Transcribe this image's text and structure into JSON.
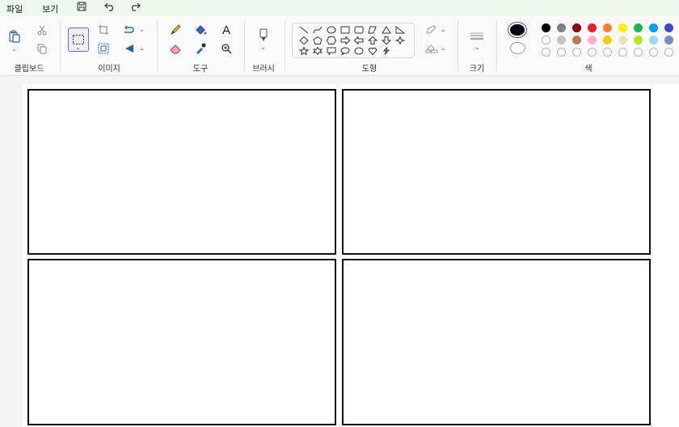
{
  "menu": {
    "file": "파일",
    "view": "보기"
  },
  "quick_access": {
    "save": "save-icon",
    "undo": "undo-icon",
    "redo": "redo-icon"
  },
  "ribbon": {
    "groups": {
      "clipboard": "클립보드",
      "image": "이미지",
      "tools": "도구",
      "brushes": "브러시",
      "shapes": "도형",
      "size": "크기",
      "colors": "색"
    },
    "tools_text_glyph": "A"
  },
  "colors": {
    "primary": "#000000",
    "secondary": "#ffffff",
    "palette_row1": [
      "#000000",
      "#7f7f7f",
      "#880015",
      "#ed1c24",
      "#ff7f27",
      "#fff200",
      "#22b14c",
      "#00a2e8",
      "#3f48cc"
    ],
    "palette_row2": [
      "#ffffff",
      "#c3c3c3",
      "#b97a57",
      "#ffaec9",
      "#ffc90e",
      "#efe4b0",
      "#b5e61d",
      "#99d9ea",
      "#7092be"
    ]
  }
}
